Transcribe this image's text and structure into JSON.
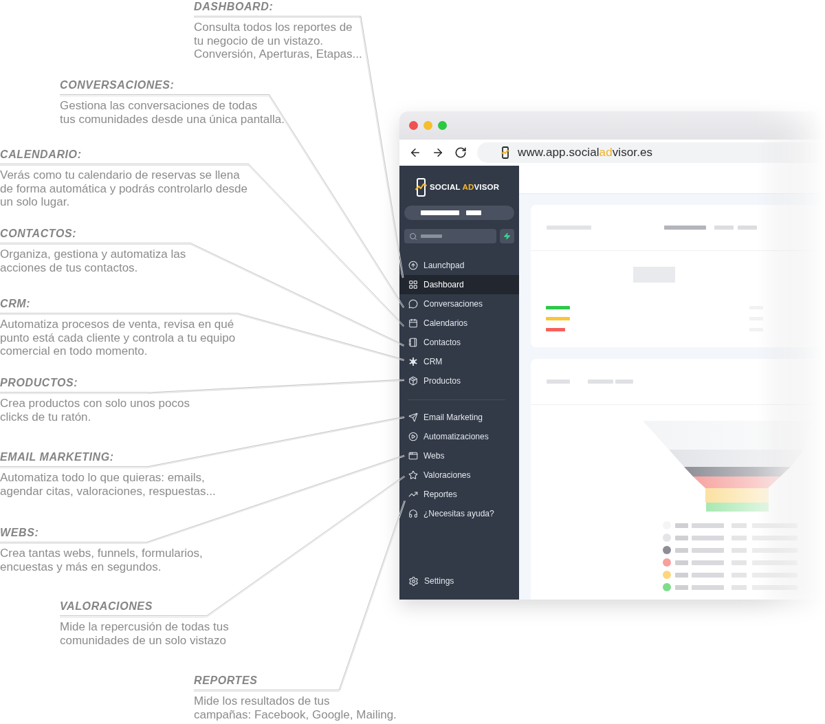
{
  "callouts": [
    {
      "title": "DASHBOARD:",
      "text": "Consulta todos los reportes de\ntu negocio de un vistazo.\nConversión, Aperturas, Etapas..."
    },
    {
      "title": "CONVERSACIONES:",
      "text": "Gestiona las conversaciones de todas\ntus comunidades desde una única pantalla."
    },
    {
      "title": "CALENDARIO:",
      "text": "Verás como tu calendario de reservas se llena\nde forma automática y podrás controlarlo desde\nun solo lugar."
    },
    {
      "title": "CONTACTOS:",
      "text": "Organiza, gestiona y automatiza las\nacciones de tus contactos."
    },
    {
      "title": "CRM:",
      "text": "Automatiza procesos de venta, revisa en qué\npunto está cada cliente y controla a tu equipo\ncomercial en todo momento."
    },
    {
      "title": "PRODUCTOS:",
      "text": "Crea productos con solo unos pocos\nclicks de tu ratón."
    },
    {
      "title": "EMAIL MARKETING:",
      "text": "Automatiza todo lo que quieras: emails,\nagendar citas, valoraciones, respuestas..."
    },
    {
      "title": "WEBS:",
      "text": "Crea tantas webs, funnels, formularios,\nencuestas y más en segundos."
    },
    {
      "title": "VALORACIONES",
      "text": "Mide la repercusión de todas tus\ncomunidades de un solo vistazo"
    },
    {
      "title": "REPORTES",
      "text": "Mide los resultados de tus\ncampañas: Facebook, Google, Mailing."
    }
  ],
  "browser": {
    "url": [
      {
        "text": "www.app.social",
        "highlight": false
      },
      {
        "text": "ad",
        "highlight": true
      },
      {
        "text": "visor.es",
        "highlight": false
      }
    ]
  },
  "sidebar": {
    "logo": [
      {
        "text": "SOCIAL ",
        "highlight": false
      },
      {
        "text": "AD",
        "highlight": true
      },
      {
        "text": "VISOR",
        "highlight": false
      }
    ],
    "main_items": [
      {
        "label": "Launchpad",
        "selected": false
      },
      {
        "label": "Dashboard",
        "selected": true
      },
      {
        "label": "Conversaciones",
        "selected": false
      },
      {
        "label": "Calendarios",
        "selected": false
      },
      {
        "label": "Contactos",
        "selected": false
      },
      {
        "label": "CRM",
        "selected": false
      },
      {
        "label": "Productos",
        "selected": false
      }
    ],
    "tool_items": [
      {
        "label": "Email Marketing",
        "selected": false
      },
      {
        "label": "Automatizaciones",
        "selected": false
      },
      {
        "label": "Webs",
        "selected": false
      },
      {
        "label": "Valoraciones",
        "selected": false
      },
      {
        "label": "Reportes",
        "selected": false
      },
      {
        "label": "¿Necesitas ayuda?",
        "selected": false
      }
    ],
    "settings": {
      "label": "Settings",
      "selected": false
    }
  },
  "dashboard": {
    "status_bars": [
      {
        "color": "#2ec84a"
      },
      {
        "color": "#fbc536"
      },
      {
        "color": "#f5615a"
      }
    ],
    "funnel_legend": [
      {
        "color": "#f4f5f6"
      },
      {
        "color": "#e4e5e8"
      },
      {
        "color": "#8c8d96"
      },
      {
        "color": "#f7a09c"
      },
      {
        "color": "#fdd77e"
      },
      {
        "color": "#7fdc8c"
      }
    ]
  }
}
